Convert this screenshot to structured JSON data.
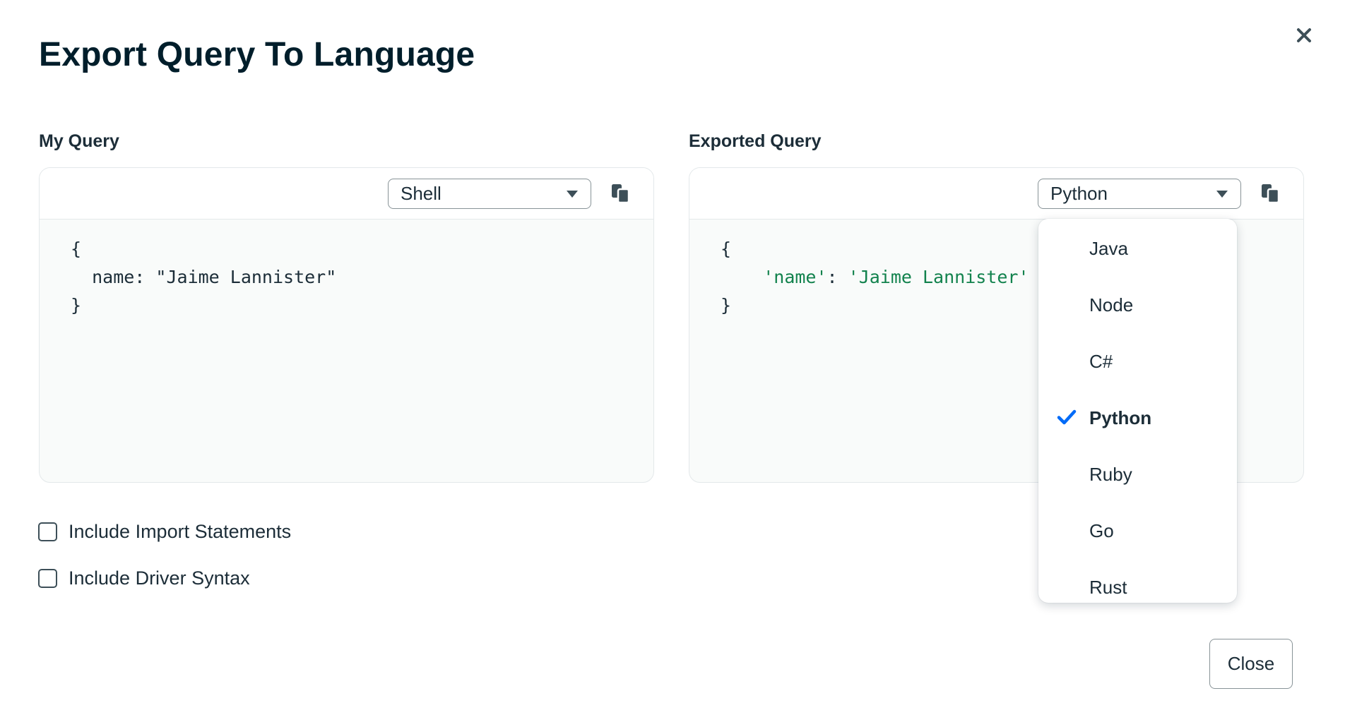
{
  "dialog": {
    "title": "Export Query To Language",
    "close_icon": "close-x-icon",
    "close_button_label": "Close"
  },
  "my_query": {
    "label": "My Query",
    "language": "Shell",
    "code_lines": [
      "{",
      "  name: \"Jaime Lannister\"",
      "}"
    ]
  },
  "exported_query": {
    "label": "Exported Query",
    "language": "Python",
    "code": {
      "open": "{",
      "key": "'name'",
      "sep": ": ",
      "value": "'Jaime Lannister'",
      "close": "}"
    }
  },
  "options": {
    "include_imports": {
      "label": "Include Import Statements",
      "checked": false
    },
    "include_driver": {
      "label": "Include Driver Syntax",
      "checked": false
    }
  },
  "language_menu": {
    "items": [
      {
        "label": "Java"
      },
      {
        "label": "Node"
      },
      {
        "label": "C#"
      },
      {
        "label": "Python",
        "selected": true
      },
      {
        "label": "Ruby"
      },
      {
        "label": "Go"
      },
      {
        "label": "Rust"
      }
    ]
  },
  "colors": {
    "title": "#001e2b",
    "code_string": "#12824d",
    "check_accent": "#016bf8",
    "border": "#e3e8ea"
  }
}
